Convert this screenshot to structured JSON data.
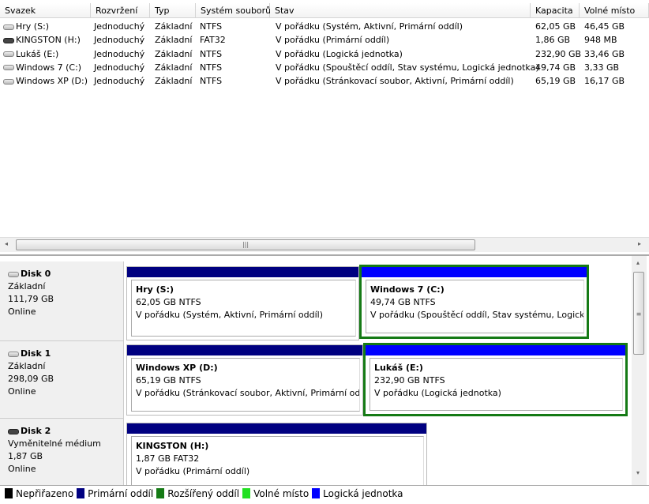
{
  "columns": [
    "Svazek",
    "Rozvržení",
    "Typ",
    "Systém souborů",
    "Stav",
    "Kapacita",
    "Volné místo"
  ],
  "volumes": [
    {
      "name": "Hry (S:)",
      "layout": "Jednoduchý",
      "type": "Základní",
      "fs": "NTFS",
      "status": "V pořádku (Systém, Aktivní, Primární oddíl)",
      "capacity": "62,05 GB",
      "free": "46,45 GB",
      "icon": "hdd-icon"
    },
    {
      "name": "KINGSTON (H:)",
      "layout": "Jednoduchý",
      "type": "Základní",
      "fs": "FAT32",
      "status": "V pořádku (Primární oddíl)",
      "capacity": "1,86 GB",
      "free": "948 MB",
      "icon": "removable-drive-icon"
    },
    {
      "name": "Lukáš (E:)",
      "layout": "Jednoduchý",
      "type": "Základní",
      "fs": "NTFS",
      "status": "V pořádku (Logická jednotka)",
      "capacity": "232,90 GB",
      "free": "33,46 GB",
      "icon": "hdd-icon"
    },
    {
      "name": "Windows 7 (C:)",
      "layout": "Jednoduchý",
      "type": "Základní",
      "fs": "NTFS",
      "status": "V pořádku (Spouštěcí oddíl, Stav systému, Logická jednotka)",
      "capacity": "49,74 GB",
      "free": "3,33 GB",
      "icon": "hdd-icon"
    },
    {
      "name": "Windows XP (D:)",
      "layout": "Jednoduchý",
      "type": "Základní",
      "fs": "NTFS",
      "status": "V pořádku (Stránkovací soubor, Aktivní, Primární oddíl)",
      "capacity": "65,19 GB",
      "free": "16,17 GB",
      "icon": "hdd-icon"
    }
  ],
  "disks": [
    {
      "name": "Disk 0",
      "type": "Základní",
      "size": "111,79 GB",
      "state": "Online",
      "partitions": [
        {
          "title": "Hry  (S:)",
          "size": "62,05 GB NTFS",
          "status": "V pořádku (Systém, Aktivní, Primární oddíl)"
        },
        {
          "title": "Windows 7  (C:)",
          "size": "49,74 GB NTFS",
          "status": "V pořádku (Spouštěcí oddíl, Stav systému, Logická jednotka)"
        }
      ]
    },
    {
      "name": "Disk 1",
      "type": "Základní",
      "size": "298,09 GB",
      "state": "Online",
      "partitions": [
        {
          "title": "Windows XP  (D:)",
          "size": "65,19 GB NTFS",
          "status": "V pořádku (Stránkovací soubor, Aktivní, Primární oddíl)"
        },
        {
          "title": "Lukáš  (E:)",
          "size": "232,90 GB NTFS",
          "status": "V pořádku (Logická jednotka)"
        }
      ]
    },
    {
      "name": "Disk 2",
      "type": "Vyměnitelné médium",
      "size": "1,87 GB",
      "state": "Online",
      "partitions": [
        {
          "title": "KINGSTON  (H:)",
          "size": "1,87 GB FAT32",
          "status": "V pořádku (Primární oddíl)"
        }
      ]
    }
  ],
  "legend": [
    {
      "label": "Nepřiřazeno",
      "color": "#000000"
    },
    {
      "label": "Primární oddíl",
      "color": "#000080"
    },
    {
      "label": "Rozšířený oddíl",
      "color": "#157a15"
    },
    {
      "label": "Volné místo",
      "color": "#22e022"
    },
    {
      "label": "Logická jednotka",
      "color": "#0000ff"
    }
  ],
  "colors": {
    "primary": "#000080",
    "logical": "#0000ff",
    "selected": "#157a15"
  }
}
